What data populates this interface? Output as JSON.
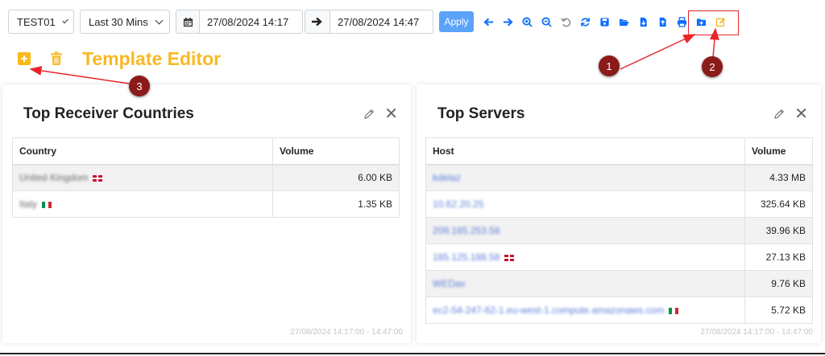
{
  "toolbar": {
    "database": "TEST01",
    "range": "Last 30 Mins",
    "date_from": "27/08/2024 14:17",
    "date_to": "27/08/2024 14:47",
    "apply": "Apply",
    "icons": [
      "arrow-left-icon",
      "arrow-right-icon",
      "zoom-in-icon",
      "zoom-out-icon",
      "undo-icon",
      "refresh-icon",
      "save-icon",
      "folder-open-icon",
      "file-export-icon",
      "file-import-icon",
      "print-icon",
      "folder-plus-icon",
      "edit-template-icon"
    ]
  },
  "template_editor": {
    "title": "Template Editor",
    "accent": "#f7b924"
  },
  "annotations": {
    "one": "1",
    "two": "2",
    "three": "3",
    "color": "#8b1a1a"
  },
  "left_panel": {
    "title": "Top Receiver Countries",
    "columns": [
      "Country",
      "Volume"
    ],
    "rows": [
      {
        "name": "United Kingdom",
        "volume": "6.00 KB"
      },
      {
        "name": "Italy",
        "volume": "1.35 KB"
      }
    ],
    "timestamp": "27/08/2024 14:17:00 - 14:47:00"
  },
  "right_panel": {
    "title": "Top Servers",
    "columns": [
      "Host",
      "Volume"
    ],
    "rows": [
      {
        "name": "kdelaz",
        "volume": "4.33 MB"
      },
      {
        "name": "10.62.20.25",
        "volume": "325.64 KB"
      },
      {
        "name": "209.185.253.58",
        "volume": "39.96 KB"
      },
      {
        "name": "185.125.188.58",
        "volume": "27.13 KB"
      },
      {
        "name": "WEDav",
        "volume": "9.76 KB"
      },
      {
        "name": "ec2-54-247-62-1.eu-west-1.compute.amazonaws.com",
        "volume": "5.72 KB"
      }
    ],
    "timestamp": "27/08/2024 14:17:00 - 14:47:00"
  }
}
